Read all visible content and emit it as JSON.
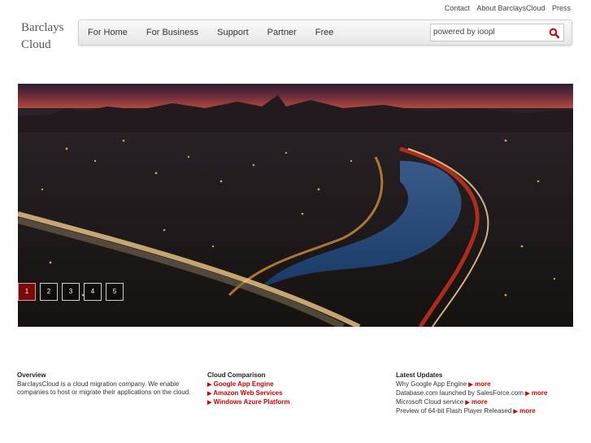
{
  "top_links": [
    "Contact",
    "About BarclaysCloud",
    "Press"
  ],
  "logo": {
    "line1": "Barclays",
    "line2": "Cloud"
  },
  "nav": [
    "For Home",
    "For Business",
    "Support",
    "Partner",
    "Free"
  ],
  "search": {
    "value": "powered by ioopl",
    "icon": "magnifier-icon"
  },
  "slider": {
    "buttons": [
      "1",
      "2",
      "3",
      "4",
      "5"
    ],
    "active": 0
  },
  "overview": {
    "title": "Overview",
    "text": "BarclaysCloud is a cloud migration company. We enable companies to host or migrate their applications on the cloud."
  },
  "comparison": {
    "title": "Cloud Comparison",
    "links": [
      "Google App Engine",
      "Amazon Web Services",
      "Windows Azure Platform"
    ]
  },
  "updates": {
    "title": "Latest Updates",
    "items": [
      "Why Google App Engine",
      "Database.com launched by SalesForce.com",
      "Microsoft Cloud service",
      "Preview of 64-bit Flash Player Released"
    ],
    "more_label": "more"
  },
  "colors": {
    "accent": "#cc0000",
    "active_slide": "#7a0a0a"
  }
}
